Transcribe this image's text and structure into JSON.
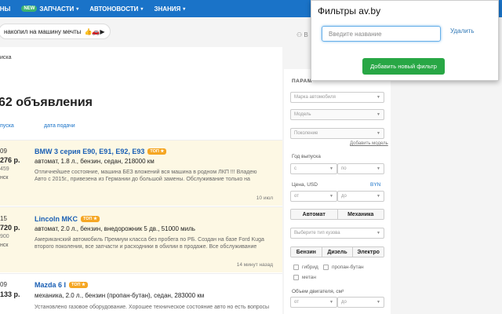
{
  "nav": {
    "items": [
      {
        "label": "ИНЫ",
        "new": false
      },
      {
        "label": "ЗАПЧАСТИ",
        "new": true
      },
      {
        "label": "АВТОНОВОСТИ",
        "new": false
      },
      {
        "label": "ЗНАНИЯ",
        "new": false
      }
    ],
    "new_badge": "NEW"
  },
  "promo": {
    "text": "накопил на машину мечты",
    "emoji": "👍🚗▶"
  },
  "header_icon_label": "В",
  "main": {
    "crumb": "иска",
    "title": "62 объявления",
    "sort_year": "пуска",
    "sort_date": "дата подачи"
  },
  "ads": [
    {
      "year": "09",
      "price": "276 р.",
      "price_usd": "459",
      "city": "нск",
      "name": "BMW 3 серия E90, E91, E92, E93",
      "top_label": "ТОП",
      "params": "автомат, 1.8 л., бензин, седан, 218000 км",
      "desc": "Отличнейшее состояние, машина БЕЗ вложений вся машина в родном ЛКП !!! Владею Авто с 2015г., привезена из Германии до большой замены. Обслуживание только на",
      "time": "10 июл"
    },
    {
      "year": "15",
      "price": "720 р.",
      "price_usd": "900",
      "city": "нск",
      "name": "Lincoln MKC",
      "top_label": "ТОП",
      "params": "автомат, 2.0 л., бензин, внедорожник 5 дв., 51000 миль",
      "desc": "Американский автомобиль Премиум класса без пробега по РБ. Создан на базе Ford Kuga второго поколения, все запчасти и расходники в обилии в продаже. Все обслуживание",
      "time": "14 минут назад"
    },
    {
      "year": "09",
      "price": "133 р.",
      "price_usd": "",
      "city": "",
      "name": "Mazda 6 I",
      "top_label": "ТОП",
      "params": "механика, 2.0 л., бензин (пропан-бутан), седан, 283000 км",
      "desc": "Установлено газовое оборудование. Хорошее техническое состояние авто но есть вопросы",
      "time": ""
    }
  ],
  "filters": {
    "heading": "ПАРАМ",
    "brand": "Марка автомобиля",
    "model": "Модель",
    "generation": "Поколение",
    "add_model": "Добавить модель",
    "year_label": "Год выпуска",
    "from": "с",
    "to": "по",
    "price_label": "Цена, USD",
    "currency": "BYN",
    "price_from": "от",
    "price_to": "до",
    "gearbox": [
      "Автомат",
      "Механика"
    ],
    "body": "Выберите тип кузова",
    "engine": [
      "Бензин",
      "Дизель",
      "Электро"
    ],
    "hybrid": "гибрид",
    "propane": "пропан-бутан",
    "methane": "метан",
    "volume_label": "Объем двигателя, см³",
    "vol_from": "от",
    "vol_to": "до"
  },
  "popup": {
    "title": "Фильтры av.by",
    "placeholder": "Введите название",
    "delete_label": "Удалить",
    "add_label": "Добавить новый фильтр"
  }
}
